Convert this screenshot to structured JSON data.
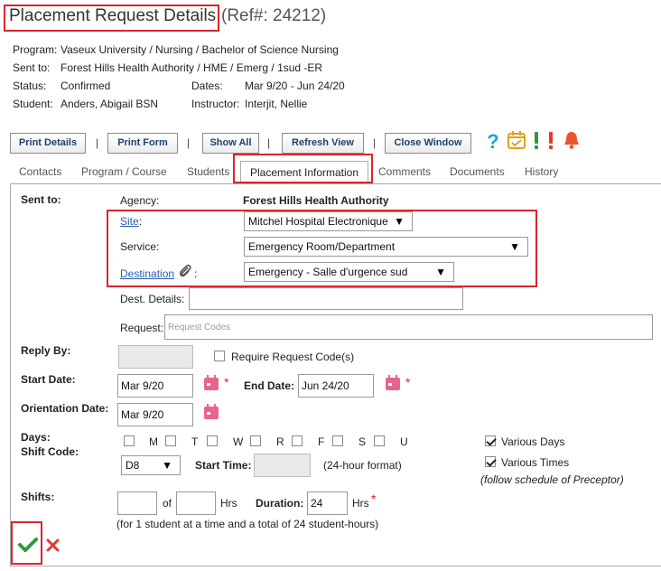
{
  "header": {
    "title": "Placement Request Details",
    "ref": "(Ref#: 24212)"
  },
  "info": {
    "program_label": "Program:",
    "program_value": "Vaseux University / Nursing / Bachelor of Science Nursing",
    "sent_to_label": "Sent to:",
    "sent_to_value": "Forest Hills Health Authority / HME / Emerg / 1sud -ER",
    "status_label": "Status:",
    "status_value": "Confirmed",
    "dates_label": "Dates:",
    "dates_value": "Mar 9/20 - Jun 24/20",
    "student_label": "Student:",
    "student_value": "Anders, Abigail BSN",
    "instructor_label": "Instructor:",
    "instructor_value": "Interjit, Nellie"
  },
  "toolbar": {
    "print_details": "Print Details",
    "print_form": "Print Form",
    "show_all": "Show All",
    "refresh_view": "Refresh View",
    "close_window": "Close Window",
    "separator": "|",
    "icons": [
      "help-icon",
      "calendar-check-icon",
      "alert-green-icon",
      "alert-red-icon",
      "bell-icon"
    ]
  },
  "tabs": {
    "contacts": "Contacts",
    "program_course": "Program / Course",
    "students": "Students",
    "placement_information": "Placement Information",
    "comments": "Comments",
    "documents": "Documents",
    "history": "History"
  },
  "form": {
    "sent_to_label": "Sent to:",
    "agency_label": "Agency:",
    "agency_value": "Forest Hills Health Authority",
    "site_label": "Site",
    "site_colon": ":",
    "site_value": "Mitchel Hospital Electronique",
    "service_label": "Service:",
    "service_value": "Emergency Room/Department",
    "destination_label": "Destination",
    "destination_colon": ":",
    "destination_value": "Emergency - Salle d'urgence sud",
    "dest_details_label": "Dest. Details:",
    "dest_details_value": "",
    "request_label": "Request:",
    "request_placeholder": "Request Codes",
    "reply_by_label": "Reply By:",
    "require_code_label": "Require Request Code(s)",
    "start_date_label": "Start Date:",
    "start_date_value": "Mar 9/20",
    "end_date_label": "End Date:",
    "end_date_value": "Jun 24/20",
    "orientation_label": "Orientation Date:",
    "orientation_value": "Mar 9/20",
    "days_label": "Days:",
    "shift_code_label": "Shift Code:",
    "days": [
      "M",
      "T",
      "W",
      "R",
      "F",
      "S",
      "U"
    ],
    "various_days_label": "Various Days",
    "various_times_label": "Various Times",
    "preceptor_note": "(follow schedule of Preceptor)",
    "shift_code_value": "D8",
    "start_time_label": "Start Time:",
    "time_format_note": "(24-hour format)",
    "shifts_label": "Shifts:",
    "of_label": "of",
    "hrs_label": "Hrs",
    "duration_label": "Duration:",
    "duration_value": "24",
    "duration_hrs_label": "Hrs",
    "required_mark": "*",
    "summary_note": "(for 1 student at a time and a total of 24 student-hours)"
  },
  "colors": {
    "highlight_red": "#d9262c",
    "link_blue": "#2a5db0",
    "save_green": "#2e9a3a",
    "cancel_red": "#e03b2f",
    "calendar_pink": "#e8658a"
  }
}
